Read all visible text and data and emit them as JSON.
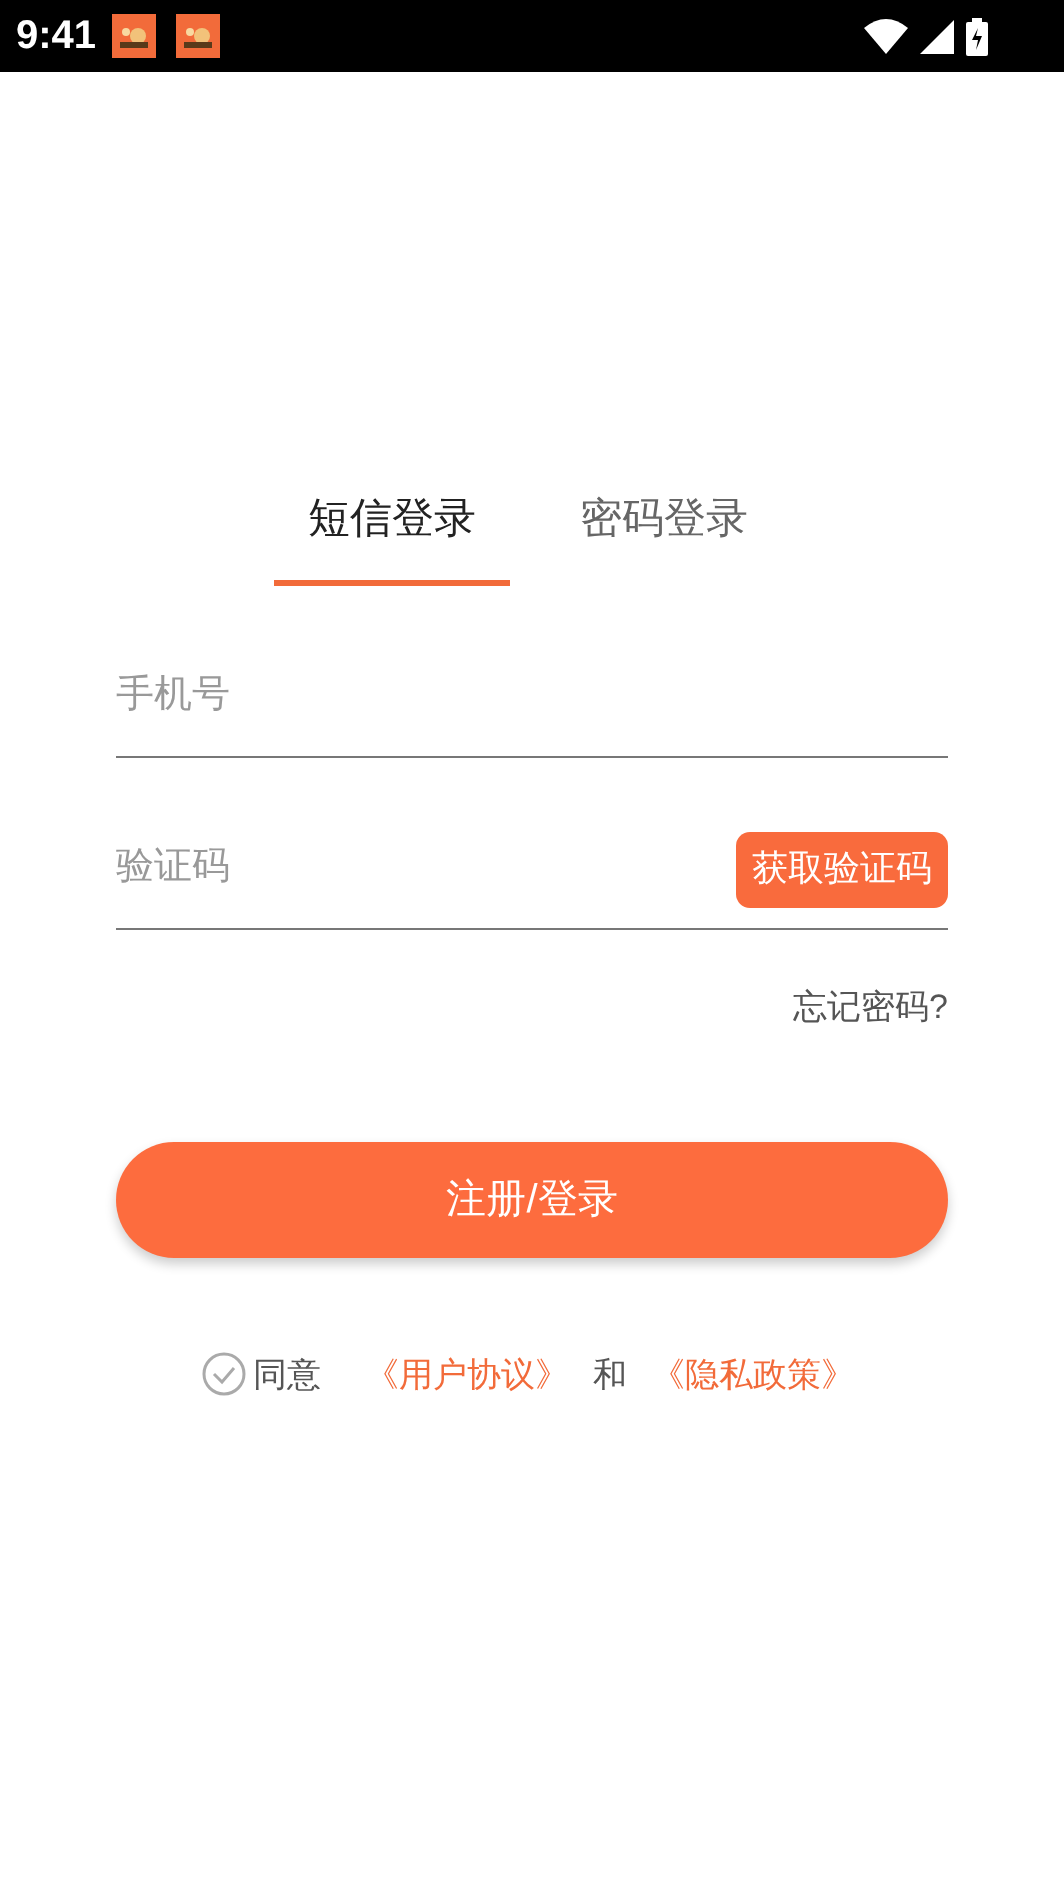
{
  "status_bar": {
    "time": "9:41",
    "notifications": [
      {
        "kind": "app"
      },
      {
        "kind": "app"
      }
    ]
  },
  "tabs": [
    {
      "label": "短信登录",
      "selected": true
    },
    {
      "label": "密码登录",
      "selected": false
    }
  ],
  "phone_field": {
    "placeholder": "手机号"
  },
  "code_field": {
    "placeholder": "验证码",
    "get_code_button": "获取验证码"
  },
  "forgot_password": "忘记密码?",
  "submit_button": "注册/登录",
  "agreement": {
    "checked": false,
    "prefix": "同意",
    "user_agreement": "《用户协议》",
    "conjunction": "和",
    "privacy_policy": "《隐私政策》"
  }
}
